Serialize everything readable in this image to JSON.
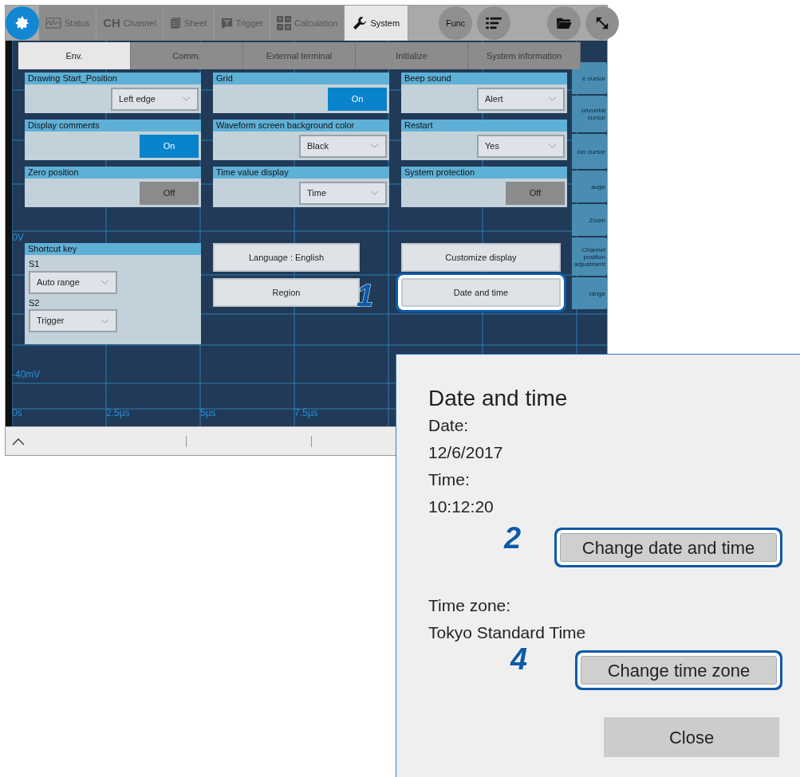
{
  "app": {
    "main_tabs": [
      {
        "label": "Status",
        "selected": false
      },
      {
        "label": "Channel",
        "icon_text": "CH",
        "selected": false
      },
      {
        "label": "Sheet",
        "selected": false
      },
      {
        "label": "Trigger",
        "selected": false
      },
      {
        "label": "Calculation",
        "selected": false
      },
      {
        "label": "System",
        "selected": true
      }
    ],
    "round_buttons": [
      {
        "kind": "text",
        "label": "Func"
      },
      {
        "kind": "list"
      },
      {
        "kind": "folder"
      },
      {
        "kind": "resize"
      }
    ],
    "sub_tabs": [
      {
        "label": "Env.",
        "selected": true
      },
      {
        "label": "Comm.",
        "selected": false
      },
      {
        "label": "External terminal",
        "selected": false
      },
      {
        "label": "Initialize",
        "selected": false
      },
      {
        "label": "System information",
        "selected": false
      }
    ],
    "settings": [
      {
        "title": "Drawing Start_Position",
        "kind": "dropdown",
        "value": "Left edge"
      },
      {
        "title": "Grid",
        "kind": "toggle",
        "value": "On",
        "on": true
      },
      {
        "title": "Beep sound",
        "kind": "dropdown",
        "value": "Alert"
      },
      {
        "title": "Display comments",
        "kind": "toggle",
        "value": "On",
        "on": true
      },
      {
        "title": "Waveform screen background color",
        "kind": "dropdown",
        "value": "Black"
      },
      {
        "title": "Restart",
        "kind": "dropdown",
        "value": "Yes"
      },
      {
        "title": "Zero position",
        "kind": "toggle",
        "value": "Off",
        "on": false
      },
      {
        "title": "Time value display",
        "kind": "dropdown",
        "value": "Time"
      },
      {
        "title": "System protection",
        "kind": "toggle",
        "value": "Off",
        "on": false
      }
    ],
    "shortcut_key": {
      "title": "Shortcut key",
      "keys": [
        {
          "label": "S1",
          "value": "Auto range"
        },
        {
          "label": "S2",
          "value": "Trigger"
        }
      ]
    },
    "buttons": [
      {
        "label": "Language : English",
        "highlighted": false
      },
      {
        "label": "Customize display",
        "highlighted": false
      },
      {
        "label": "Region",
        "highlighted": false
      },
      {
        "label": "Date and time",
        "highlighted": true,
        "callout": "1"
      }
    ],
    "sidebar_items": [
      "e cursor",
      "orizontal cursor",
      "ion cursor",
      "auge",
      "Zoom",
      "Channel position adjustment",
      "range"
    ],
    "y_labels": [
      "0V",
      "-40mV"
    ],
    "x_labels": [
      "0s",
      "2.5µs",
      "5µs",
      "7.5µs"
    ]
  },
  "dialog": {
    "title": "Date and time",
    "date_label": "Date:",
    "date": "12/6/2017",
    "time_label": "Time:",
    "time": "10:12:20",
    "change_date_button": {
      "label": "Change date and time",
      "highlighted": true,
      "callout": "2"
    },
    "time_zone_label": "Time zone:",
    "time_zone": "Tokyo Standard Time",
    "change_time_zone_button": {
      "label": "Change time zone",
      "highlighted": true,
      "callout": "4"
    },
    "close_button": {
      "label": "Close"
    }
  }
}
